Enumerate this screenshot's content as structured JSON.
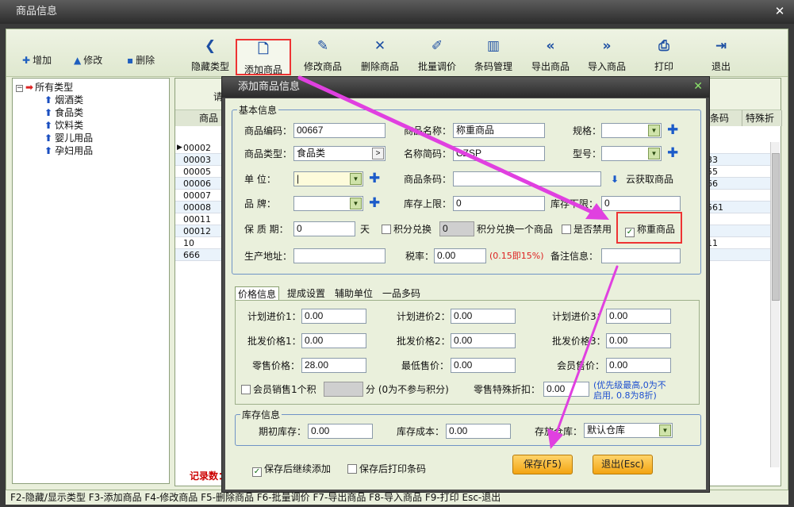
{
  "main_window": {
    "title": "商品信息"
  },
  "toolbar": {
    "mini": [
      {
        "icon": "✚",
        "label": "增加"
      },
      {
        "icon": "▲",
        "label": "修改"
      },
      {
        "icon": "▪",
        "label": "删除"
      }
    ],
    "buttons": [
      {
        "icon": "❮",
        "label": "隐藏类型"
      },
      {
        "icon": "🗋",
        "label": "添加商品"
      },
      {
        "icon": "✎",
        "label": "修改商品"
      },
      {
        "icon": "✕",
        "label": "删除商品"
      },
      {
        "icon": "✐",
        "label": "批量调价"
      },
      {
        "icon": "▥",
        "label": "条码管理"
      },
      {
        "icon": "«",
        "label": "导出商品"
      },
      {
        "icon": "»",
        "label": "导入商品"
      },
      {
        "icon": "⎙",
        "label": "打印"
      },
      {
        "icon": "⇥",
        "label": "退出"
      }
    ]
  },
  "tree": {
    "root": "所有类型",
    "children": [
      "烟酒类",
      "食品类",
      "饮料类",
      "婴儿用品",
      "孕妇用品"
    ]
  },
  "grid": {
    "header_fragment": "请",
    "col_first": "商品",
    "col_right1": "条码",
    "col_right2": "特殊折",
    "rows": [
      {
        "code": "00002",
        "right": ""
      },
      {
        "code": "00003",
        "right": "33"
      },
      {
        "code": "00005",
        "right": "55"
      },
      {
        "code": "00006",
        "right": "66"
      },
      {
        "code": "00007",
        "right": ""
      },
      {
        "code": "00008",
        "right": "561"
      },
      {
        "code": "00011",
        "right": ""
      },
      {
        "code": "00012",
        "right": ""
      },
      {
        "code": "10",
        "right": "11"
      },
      {
        "code": "666",
        "right": ""
      }
    ],
    "record_count_label": "记录数："
  },
  "status_bar": "F2-隐藏/显示类型  F3-添加商品 F4-修改商品 F5-删除商品 F6-批量调价 F7-导出商品 F8-导入商品 F9-打印 Esc-退出",
  "dialog": {
    "title": "添加商品信息",
    "basic": {
      "legend": "基本信息",
      "code_label": "商品编码：",
      "code_value": "00667",
      "name_label": "商品名称：",
      "name_value": "称重商品",
      "spec_label": "规格：",
      "type_label": "商品类型：",
      "type_value": "食品类",
      "abbr_label": "名称简码：",
      "abbr_value": "CZSP",
      "model_label": "型号：",
      "unit_label": "单      位：",
      "unit_value": "|",
      "barcode_label": "商品条码：",
      "cloud_label": "云获取商品",
      "brand_label": "品      牌：",
      "stock_upper_label": "库存上限：",
      "stock_upper_value": "0",
      "stock_lower_label": "库存下限：",
      "stock_lower_value": "0",
      "shelf_label": "保  质  期：",
      "shelf_value": "0",
      "shelf_unit": "天",
      "points_exchange_label": "积分兑换",
      "points_value": "0",
      "points_desc": "积分兑换一个商品",
      "disabled_label": "是否禁用",
      "weighing_label": "称重商品",
      "address_label": "生产地址：",
      "tax_label": "税率：",
      "tax_value": "0.00",
      "tax_hint": "(0.15即15%)",
      "remark_label": "备注信息："
    },
    "tabs": [
      "价格信息",
      "提成设置",
      "辅助单位",
      "一品多码"
    ],
    "price": {
      "plan1_label": "计划进价1：",
      "plan1": "0.00",
      "plan2_label": "计划进价2：",
      "plan2": "0.00",
      "plan3_label": "计划进价3：",
      "plan3": "0.00",
      "whole1_label": "批发价格1：",
      "whole1": "0.00",
      "whole2_label": "批发价格2：",
      "whole2": "0.00",
      "whole3_label": "批发价格3：",
      "whole3": "0.00",
      "retail_label": "零售价格：",
      "retail": "28.00",
      "min_label": "最低售价：",
      "min": "0.00",
      "member_label": "会员售价：",
      "member": "0.00",
      "member_points_label": "会员销售1个积",
      "member_points_unit": "分 (0为不参与积分)",
      "special_label": "零售特殊折扣：",
      "special": "0.00",
      "special_hint1": "(优先级最高,0为不",
      "special_hint2": "启用, 0.8为8折)"
    },
    "stock": {
      "legend": "库存信息",
      "init_label": "期初库存：",
      "init": "0.00",
      "cost_label": "库存成本：",
      "cost": "0.00",
      "wh_label": "存放仓库：",
      "wh": "默认仓库"
    },
    "continue_label": "保存后继续添加",
    "print_label": "保存后打印条码",
    "save_btn": "保存(F5)",
    "exit_btn": "退出(Esc)"
  },
  "colors": {
    "highlight": "#ee3333",
    "arrow": "#e040e0"
  }
}
